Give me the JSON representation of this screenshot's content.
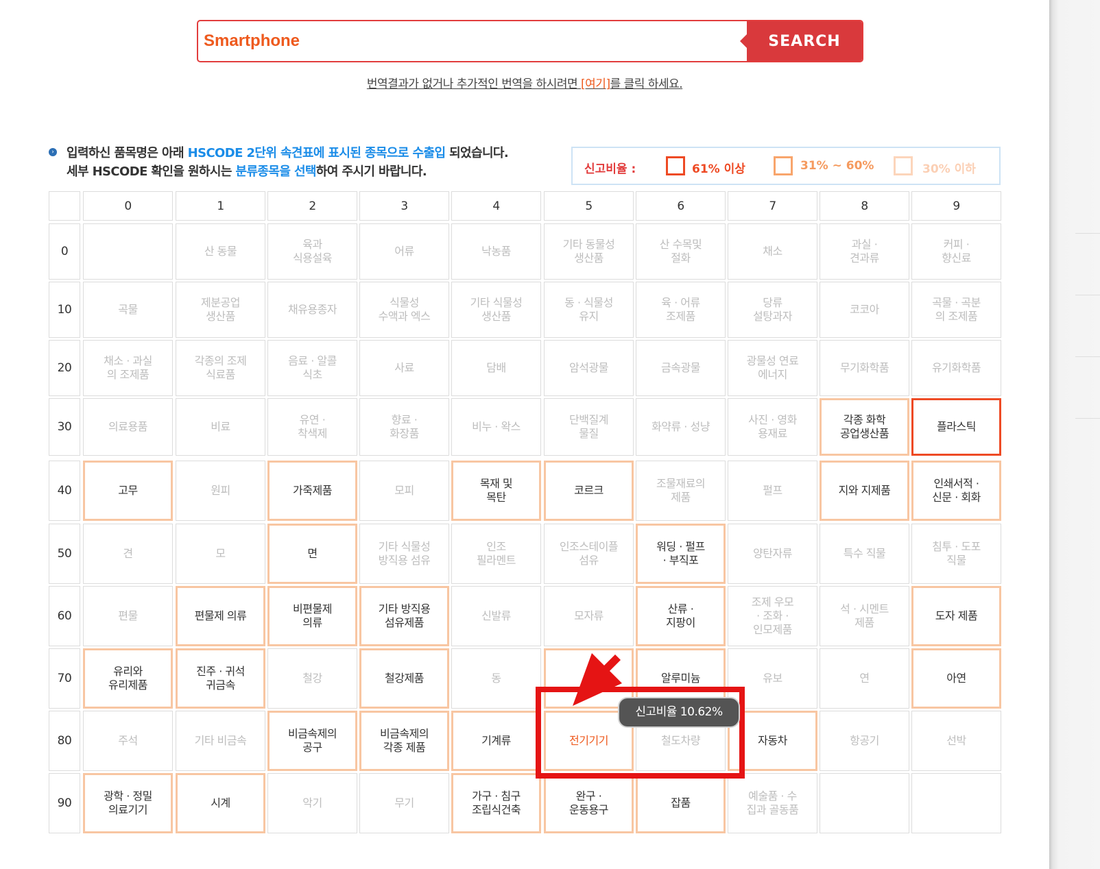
{
  "search": {
    "value": "Smartphone",
    "button_label": "SEARCH"
  },
  "notice": {
    "before": "번역결과가 없거나 추가적인 번역을 하시려면 ",
    "link": "[여기]",
    "after": "를 클릭 하세요."
  },
  "info": {
    "line1_a": "입력하신 품목명은 아래 ",
    "line1_b": "HSCODE 2단위 속견표에 표시된 종목으로 수출입",
    "line1_c": " 되었습니다.",
    "line2_a": "세부 HSCODE 확인을 원하시는 ",
    "line2_b": "분류종목을 선택",
    "line2_c": "하여 주시기 바랍니다."
  },
  "legend": {
    "title": "신고비율 :",
    "high": "61% 이상",
    "mid": "31% ~ 60%",
    "low": "30% 이하",
    "colors": {
      "high": "#ee4a24",
      "mid": "#f8a56c",
      "low": "#fcd5bb",
      "accent": "#e23c3c"
    }
  },
  "grid": {
    "col_headers": [
      "0",
      "1",
      "2",
      "3",
      "4",
      "5",
      "6",
      "7",
      "8",
      "9"
    ],
    "rows": [
      {
        "head": "0",
        "cells": [
          {
            "t": "",
            "l": "low"
          },
          {
            "t": "산 동물",
            "l": "low"
          },
          {
            "t": "육과\n식용설육",
            "l": "low"
          },
          {
            "t": "어류",
            "l": "low"
          },
          {
            "t": "낙농품",
            "l": "low"
          },
          {
            "t": "기타 동물성\n생산품",
            "l": "low"
          },
          {
            "t": "산 수목및\n절화",
            "l": "low"
          },
          {
            "t": "채소",
            "l": "low"
          },
          {
            "t": "과실 ·\n견과류",
            "l": "low"
          },
          {
            "t": "커피 ·\n향신료",
            "l": "low"
          }
        ]
      },
      {
        "head": "10",
        "cells": [
          {
            "t": "곡물",
            "l": "low"
          },
          {
            "t": "제분공업\n생산품",
            "l": "low"
          },
          {
            "t": "채유용종자",
            "l": "low"
          },
          {
            "t": "식물성\n수액과 엑스",
            "l": "low"
          },
          {
            "t": "기타 식물성\n생산품",
            "l": "low"
          },
          {
            "t": "동 · 식물성\n유지",
            "l": "low"
          },
          {
            "t": "육 · 어류\n조제품",
            "l": "low"
          },
          {
            "t": "당류\n설탕과자",
            "l": "low"
          },
          {
            "t": "코코아",
            "l": "low"
          },
          {
            "t": "곡물 · 곡분\n의 조제품",
            "l": "low"
          }
        ]
      },
      {
        "head": "20",
        "cells": [
          {
            "t": "채소 · 과실\n의 조제품",
            "l": "low"
          },
          {
            "t": "각종의 조제\n식료품",
            "l": "low"
          },
          {
            "t": "음료 · 알콜\n식초",
            "l": "low"
          },
          {
            "t": "사료",
            "l": "low"
          },
          {
            "t": "담배",
            "l": "low"
          },
          {
            "t": "암석광물",
            "l": "low"
          },
          {
            "t": "금속광물",
            "l": "low"
          },
          {
            "t": "광물성 연료\n에너지",
            "l": "low"
          },
          {
            "t": "무기화학품",
            "l": "low"
          },
          {
            "t": "유기화학품",
            "l": "low"
          }
        ]
      },
      {
        "head": "30",
        "cells": [
          {
            "t": "의료용품",
            "l": "low"
          },
          {
            "t": "비료",
            "l": "low"
          },
          {
            "t": "유연 ·\n착색제",
            "l": "low"
          },
          {
            "t": "향료 ·\n화장품",
            "l": "low"
          },
          {
            "t": "비누 · 왁스",
            "l": "low"
          },
          {
            "t": "단백질계\n물질",
            "l": "low"
          },
          {
            "t": "화약류 · 성냥",
            "l": "low"
          },
          {
            "t": "사진 · 영화\n용재료",
            "l": "low"
          },
          {
            "t": "각종 화학\n공업생산품",
            "l": "mid"
          },
          {
            "t": "플라스틱",
            "l": "high"
          }
        ]
      },
      {
        "head": "40",
        "cells": [
          {
            "t": "고무",
            "l": "mid"
          },
          {
            "t": "원피",
            "l": "low"
          },
          {
            "t": "가죽제품",
            "l": "mid"
          },
          {
            "t": "모피",
            "l": "low"
          },
          {
            "t": "목재 및\n목탄",
            "l": "mid"
          },
          {
            "t": "코르크",
            "l": "mid"
          },
          {
            "t": "조물재료의\n제품",
            "l": "low"
          },
          {
            "t": "펄프",
            "l": "low"
          },
          {
            "t": "지와 지제품",
            "l": "mid"
          },
          {
            "t": "인쇄서적 ·\n신문 · 회화",
            "l": "mid"
          }
        ]
      },
      {
        "head": "50",
        "cells": [
          {
            "t": "견",
            "l": "low"
          },
          {
            "t": "모",
            "l": "low"
          },
          {
            "t": "면",
            "l": "mid"
          },
          {
            "t": "기타 식물성\n방직용 섬유",
            "l": "low"
          },
          {
            "t": "인조\n필라멘트",
            "l": "low"
          },
          {
            "t": "인조스테이플\n섬유",
            "l": "low"
          },
          {
            "t": "워딩 · 펄프\n· 부직포",
            "l": "mid"
          },
          {
            "t": "양탄자류",
            "l": "low"
          },
          {
            "t": "특수 직물",
            "l": "low"
          },
          {
            "t": "침투 · 도포\n직물",
            "l": "low"
          }
        ]
      },
      {
        "head": "60",
        "cells": [
          {
            "t": "편물",
            "l": "low"
          },
          {
            "t": "편물제 의류",
            "l": "mid"
          },
          {
            "t": "비편물제\n의류",
            "l": "mid"
          },
          {
            "t": "기타 방직용\n섬유제품",
            "l": "mid"
          },
          {
            "t": "신발류",
            "l": "low"
          },
          {
            "t": "모자류",
            "l": "low"
          },
          {
            "t": "산류 ·\n지팡이",
            "l": "mid"
          },
          {
            "t": "조제 우모\n· 조화 ·\n인모제품",
            "l": "low"
          },
          {
            "t": "석 · 시멘트\n제품",
            "l": "low"
          },
          {
            "t": "도자 제품",
            "l": "mid"
          }
        ]
      },
      {
        "head": "70",
        "cells": [
          {
            "t": "유리와\n유리제품",
            "l": "mid"
          },
          {
            "t": "진주 · 귀석\n귀금속",
            "l": "mid"
          },
          {
            "t": "철강",
            "l": "low"
          },
          {
            "t": "철강제품",
            "l": "mid"
          },
          {
            "t": "동",
            "l": "low"
          },
          {
            "t": "",
            "l": "mid"
          },
          {
            "t": "알루미늄",
            "l": "mid"
          },
          {
            "t": "유보",
            "l": "low"
          },
          {
            "t": "연",
            "l": "low"
          },
          {
            "t": "아연",
            "l": "mid"
          }
        ]
      },
      {
        "head": "80",
        "cells": [
          {
            "t": "주석",
            "l": "low"
          },
          {
            "t": "기타 비금속",
            "l": "low"
          },
          {
            "t": "비금속제의\n공구",
            "l": "mid"
          },
          {
            "t": "비금속제의\n각종 제품",
            "l": "mid"
          },
          {
            "t": "기계류",
            "l": "mid"
          },
          {
            "t": "전기기기",
            "l": "mid",
            "active": true
          },
          {
            "t": "철도차량",
            "l": "low"
          },
          {
            "t": "자동차",
            "l": "mid"
          },
          {
            "t": "항공기",
            "l": "low"
          },
          {
            "t": "선박",
            "l": "low"
          }
        ]
      },
      {
        "head": "90",
        "cells": [
          {
            "t": "광학 · 정밀\n의료기기",
            "l": "mid"
          },
          {
            "t": "시계",
            "l": "mid"
          },
          {
            "t": "악기",
            "l": "low"
          },
          {
            "t": "무기",
            "l": "low"
          },
          {
            "t": "가구 · 침구\n조립식건축",
            "l": "mid"
          },
          {
            "t": "완구 ·\n운동용구",
            "l": "mid"
          },
          {
            "t": "잡품",
            "l": "mid"
          },
          {
            "t": "예술품 · 수\n집과 골동품",
            "l": "low"
          },
          {
            "t": "",
            "l": "low"
          },
          {
            "t": "",
            "l": "low"
          }
        ]
      }
    ]
  },
  "tooltip": {
    "text": "신고비율 10.62%"
  }
}
